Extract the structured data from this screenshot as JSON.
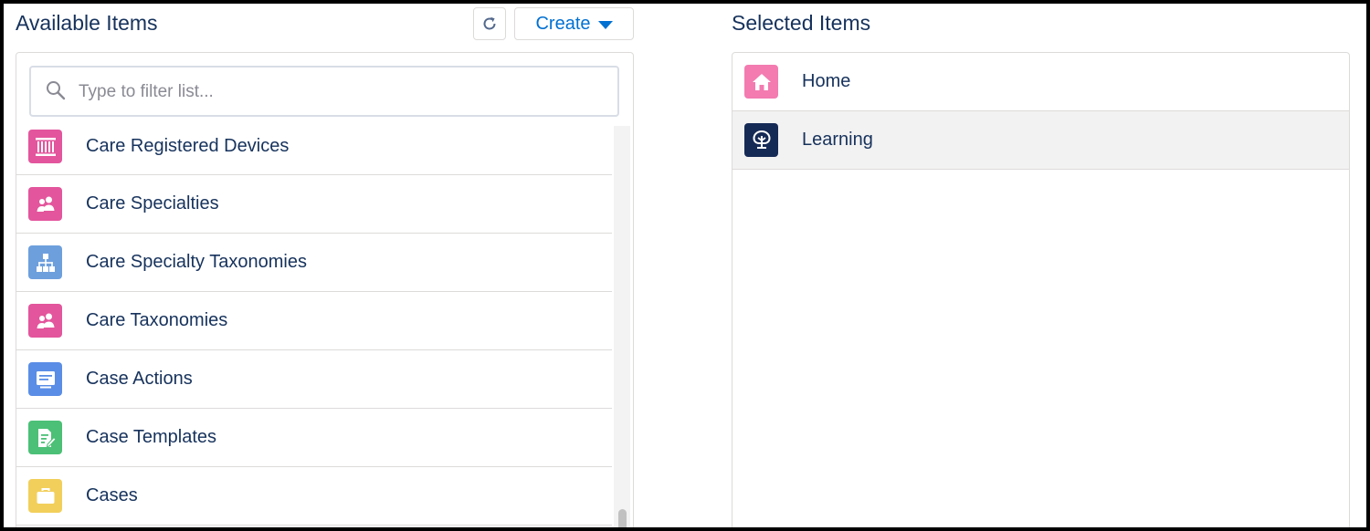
{
  "available": {
    "title": "Available Items",
    "create_label": "Create",
    "search_placeholder": "Type to filter list...",
    "items": [
      {
        "label": "Care Registered Devices",
        "icon": "barcode-icon",
        "color": "#e3559c"
      },
      {
        "label": "Care Specialties",
        "icon": "people-icon",
        "color": "#e3559c"
      },
      {
        "label": "Care Specialty Taxonomies",
        "icon": "hierarchy-icon",
        "color": "#6d9fdd"
      },
      {
        "label": "Care Taxonomies",
        "icon": "people-icon",
        "color": "#e3559c"
      },
      {
        "label": "Case Actions",
        "icon": "monitor-icon",
        "color": "#5a8de6"
      },
      {
        "label": "Case Templates",
        "icon": "document-edit-icon",
        "color": "#4bc076"
      },
      {
        "label": "Cases",
        "icon": "briefcase-icon",
        "color": "#f2cf5b"
      }
    ]
  },
  "selected": {
    "title": "Selected Items",
    "items": [
      {
        "label": "Home",
        "icon": "home-icon",
        "color": "#f37bb0"
      },
      {
        "label": "Learning",
        "icon": "learning-tree-icon",
        "color": "#162a56"
      }
    ]
  }
}
